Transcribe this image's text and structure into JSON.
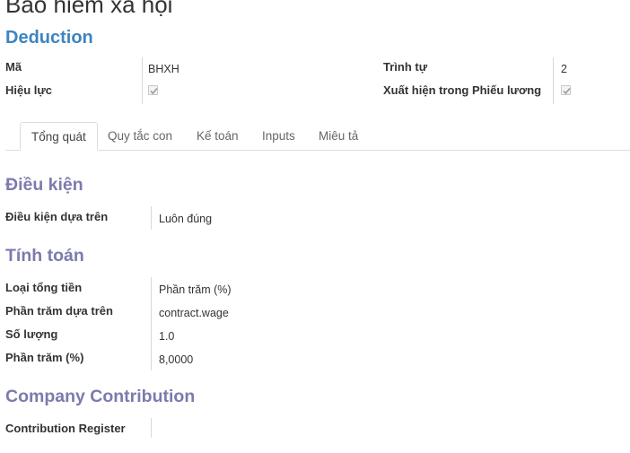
{
  "record": {
    "title": "Bảo hiểm xã hội",
    "category": "Deduction"
  },
  "header_fields": {
    "code_label": "Mã",
    "code_value": "BHXH",
    "active_label": "Hiệu lực",
    "active_checked": true,
    "sequence_label": "Trình tự",
    "sequence_value": "2",
    "appears_label": "Xuất hiện trong Phiếu lương",
    "appears_checked": true
  },
  "tabs": [
    {
      "label": "Tổng quát",
      "active": true
    },
    {
      "label": "Quy tắc con",
      "active": false
    },
    {
      "label": "Kế toán",
      "active": false
    },
    {
      "label": "Inputs",
      "active": false
    },
    {
      "label": "Miêu tả",
      "active": false
    }
  ],
  "conditions": {
    "heading": "Điều kiện",
    "based_on_label": "Điều kiện dựa trên",
    "based_on_value": "Luôn đúng"
  },
  "computation": {
    "heading": "Tính toán",
    "amount_type_label": "Loại tổng tiền",
    "amount_type_value": "Phần trăm (%)",
    "percent_base_label": "Phần trăm dựa trên",
    "percent_base_value": "contract.wage",
    "quantity_label": "Số lượng",
    "quantity_value": "1.0",
    "percentage_label": "Phần trăm (%)",
    "percentage_value": "8,0000"
  },
  "company_contribution": {
    "heading": "Company Contribution",
    "register_label": "Contribution Register",
    "register_value": ""
  },
  "colors": {
    "category": "#3d84c0",
    "section_heading": "#7c7bad",
    "text": "#333333"
  }
}
